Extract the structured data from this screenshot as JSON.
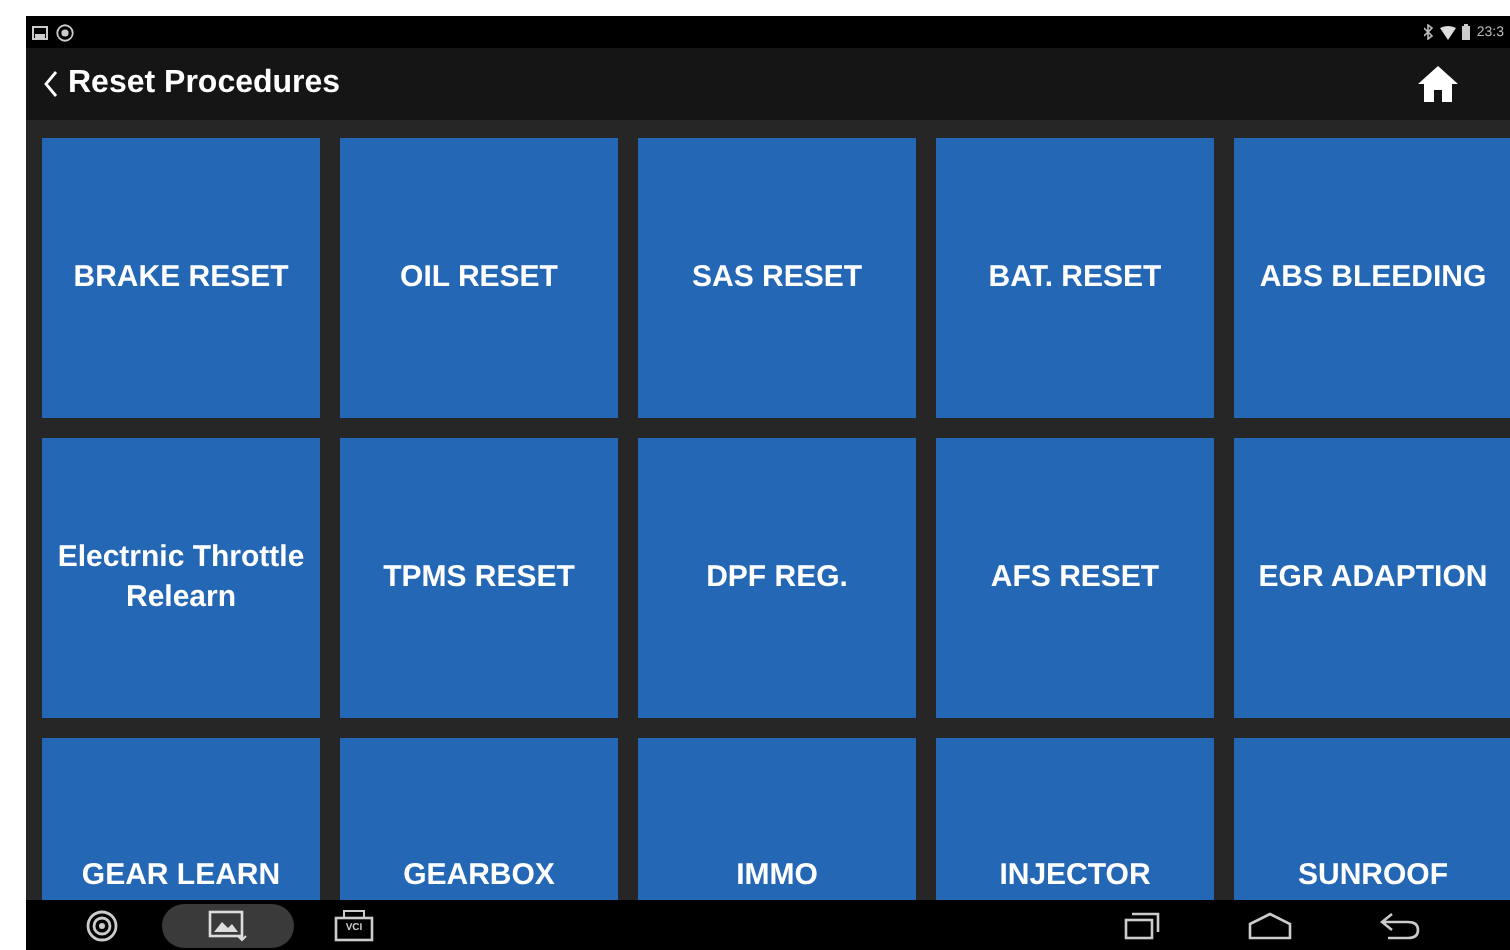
{
  "status_bar": {
    "time": "23:3"
  },
  "header": {
    "title": "Reset Procedures"
  },
  "tiles": [
    {
      "label": "BRAKE RESET"
    },
    {
      "label": "OIL RESET"
    },
    {
      "label": "SAS RESET"
    },
    {
      "label": "BAT. RESET"
    },
    {
      "label": "ABS BLEEDING"
    },
    {
      "label": "Electrnic Throttle Relearn"
    },
    {
      "label": "TPMS RESET"
    },
    {
      "label": "DPF REG."
    },
    {
      "label": "AFS RESET"
    },
    {
      "label": "EGR ADAPTION"
    },
    {
      "label": "GEAR LEARN"
    },
    {
      "label": "GEARBOX"
    },
    {
      "label": "IMMO"
    },
    {
      "label": "INJECTOR"
    },
    {
      "label": "SUNROOF"
    }
  ],
  "taskbar": [
    {
      "selected": false
    },
    {
      "selected": true
    },
    {
      "label": "VCI",
      "selected": false
    }
  ]
}
